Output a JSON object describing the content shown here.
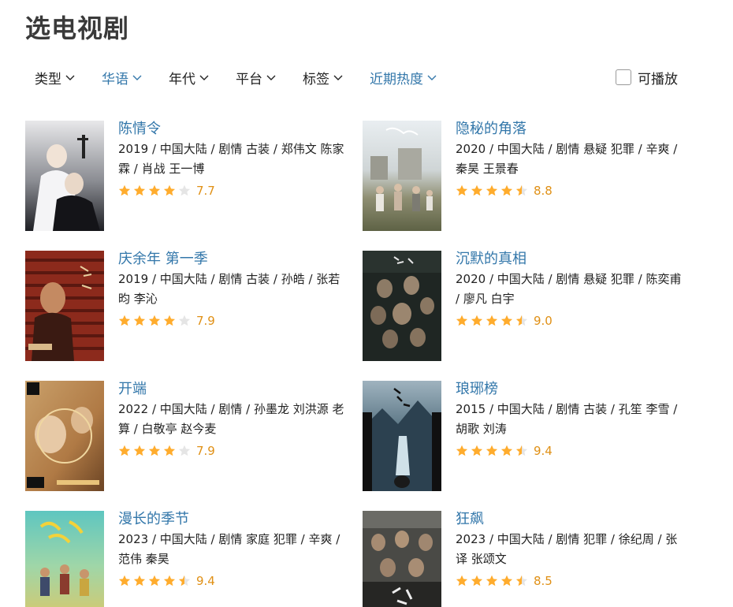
{
  "page": {
    "title": "选电视剧"
  },
  "filters": [
    {
      "label": "类型",
      "active": false
    },
    {
      "label": "华语",
      "active": true
    },
    {
      "label": "年代",
      "active": false
    },
    {
      "label": "平台",
      "active": false
    },
    {
      "label": "标签",
      "active": false
    },
    {
      "label": "近期热度",
      "active": true
    }
  ],
  "playable": {
    "label": "可播放",
    "checked": false
  },
  "colors": {
    "link": "#3377aa",
    "star": "#ffac2d",
    "star_empty": "#e5e5e5",
    "score": "#e09015"
  },
  "items": [
    {
      "title": "陈情令",
      "meta": "2019 / 中国大陆 / 剧情 古装 / 郑伟文 陈家霖 / 肖战 王一博",
      "rating": 7.7,
      "stars": 4.0
    },
    {
      "title": "隐秘的角落",
      "meta": "2020 / 中国大陆 / 剧情 悬疑 犯罪 / 辛爽 / 秦昊 王景春",
      "rating": 8.8,
      "stars": 4.5
    },
    {
      "title": "庆余年 第一季",
      "meta": "2019 / 中国大陆 / 剧情 古装 / 孙皓 / 张若昀 李沁",
      "rating": 7.9,
      "stars": 4.0
    },
    {
      "title": "沉默的真相",
      "meta": "2020 / 中国大陆 / 剧情 悬疑 犯罪 / 陈奕甫 / 廖凡 白宇",
      "rating": 9.0,
      "stars": 4.5
    },
    {
      "title": "开端",
      "meta": "2022 / 中国大陆 / 剧情 / 孙墨龙 刘洪源 老算 / 白敬亭 赵今麦",
      "rating": 7.9,
      "stars": 4.0
    },
    {
      "title": "琅琊榜",
      "meta": "2015 / 中国大陆 / 剧情 古装 / 孔笙 李雪 / 胡歌 刘涛",
      "rating": 9.4,
      "stars": 4.5
    },
    {
      "title": "漫长的季节",
      "meta": "2023 / 中国大陆 / 剧情 家庭 犯罪 / 辛爽 / 范伟 秦昊",
      "rating": 9.4,
      "stars": 4.5
    },
    {
      "title": "狂飙",
      "meta": "2023 / 中国大陆 / 剧情 犯罪 / 徐纪周 / 张译 张颂文",
      "rating": 8.5,
      "stars": 4.5
    }
  ]
}
